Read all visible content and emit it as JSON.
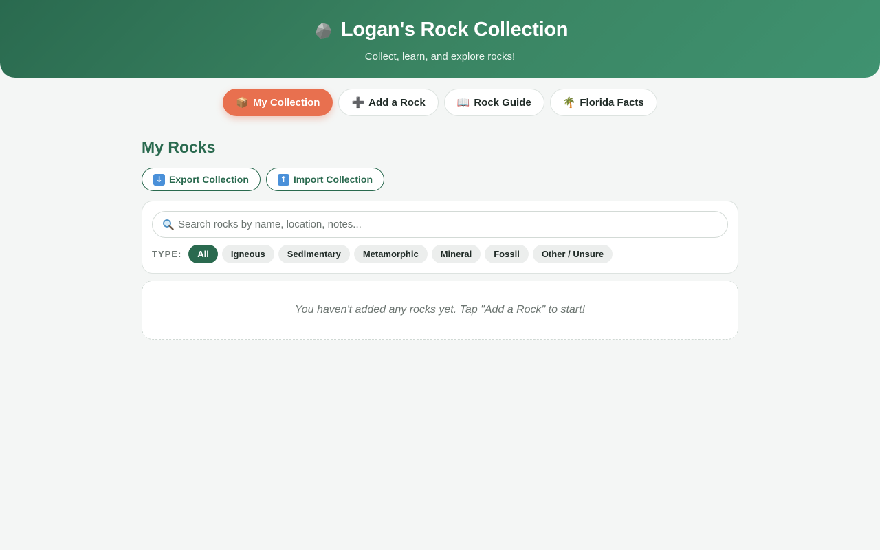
{
  "header": {
    "title": "Logan's Rock Collection",
    "subtitle": "Collect, learn, and explore rocks!",
    "icon": "rock-icon"
  },
  "nav": {
    "tabs": [
      {
        "label": "My Collection",
        "icon": "package-icon",
        "glyph": "📦",
        "active": true
      },
      {
        "label": "Add a Rock",
        "icon": "plus-icon",
        "glyph": "➕",
        "active": false
      },
      {
        "label": "Rock Guide",
        "icon": "book-icon",
        "glyph": "📖",
        "active": false
      },
      {
        "label": "Florida Facts",
        "icon": "palm-tree-icon",
        "glyph": "🌴",
        "active": false
      }
    ]
  },
  "main": {
    "title": "My Rocks",
    "export_label": "Export Collection",
    "export_icon": "download-arrow-icon",
    "import_label": "Import Collection",
    "import_icon": "upload-arrow-icon",
    "search": {
      "placeholder": "Search rocks by name, location, notes...",
      "value": ""
    },
    "type_label": "TYPE:",
    "types": [
      "All",
      "Igneous",
      "Sedimentary",
      "Metamorphic",
      "Mineral",
      "Fossil",
      "Other / Unsure"
    ],
    "active_type": "All",
    "empty_message": "You haven't added any rocks yet. Tap \"Add a Rock\" to start!"
  },
  "colors": {
    "brand_green": "#2a6a4f",
    "accent_orange": "#e8704f",
    "background": "#f4f6f5"
  }
}
